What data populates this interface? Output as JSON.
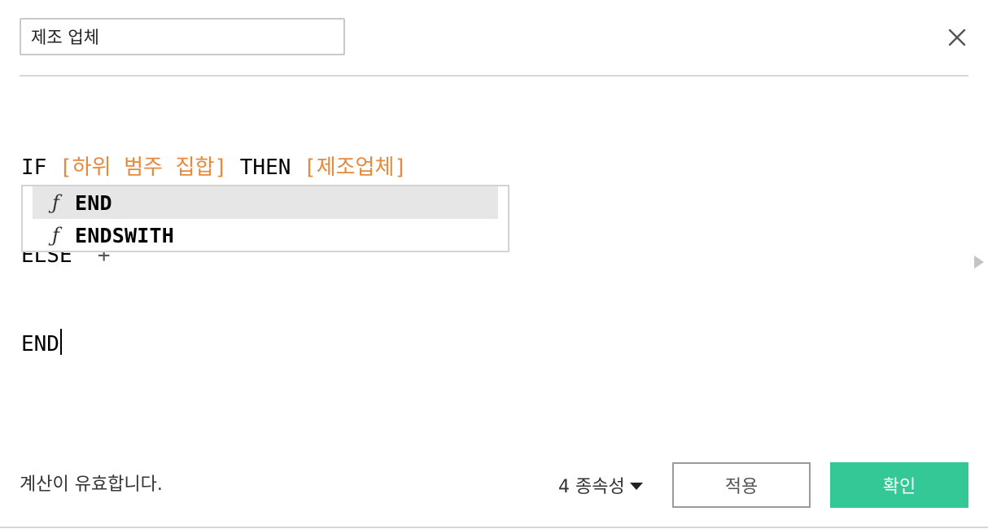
{
  "calc_name": {
    "value": "제조 업체"
  },
  "close_button": {
    "icon": "close-icon"
  },
  "formula": {
    "line1": {
      "kw_if": "IF",
      "field_subcategory_set": "[하위 범주 집합]",
      "kw_then": "THEN",
      "field_manufacturer": "[제조업체]"
    },
    "line2": {
      "kw_else": "ELSE",
      "string_literal": "'+'"
    },
    "line3": {
      "kw_end": "END"
    }
  },
  "autocomplete": {
    "items": [
      {
        "icon": "function-icon",
        "icon_glyph": "ƒ",
        "label": "END",
        "selected": true
      },
      {
        "icon": "function-icon",
        "icon_glyph": "ƒ",
        "label": "ENDSWITH",
        "selected": false
      }
    ]
  },
  "footer": {
    "status": "계산이 유효합니다.",
    "dependencies": "4 종속성",
    "apply_label": "적용",
    "ok_label": "확인"
  },
  "colors": {
    "field": "#e8883a",
    "ok_button": "#33c896",
    "selected_row": "#e6e6e6"
  }
}
